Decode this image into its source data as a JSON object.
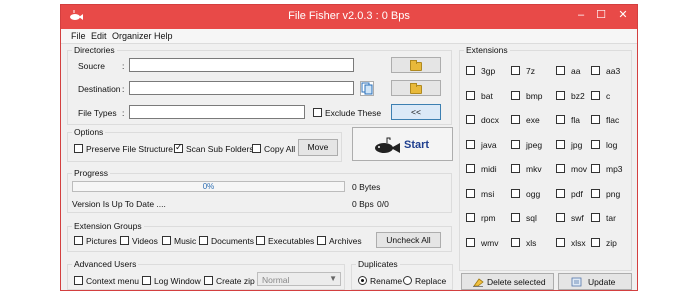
{
  "window": {
    "title": "File Fisher v2.0.3 : 0 Bps",
    "minimize": "–",
    "maximize": "☐",
    "close": "✕"
  },
  "menu": [
    "File",
    "Edit",
    "Organizer",
    "Help"
  ],
  "directories": {
    "legend": "Directories",
    "source_label": "Soucre",
    "destination_label": "Destination",
    "filetypes_label": "File Types",
    "colon": ":",
    "source_value": "",
    "destination_value": "",
    "filetypes_value": "",
    "exclude_label": "Exclude These",
    "toggle_button": "<<"
  },
  "options": {
    "legend": "Options",
    "preserve_label": "Preserve File Structure",
    "scan_sub_label": "Scan Sub Folders",
    "copy_all_label": "Copy All",
    "move_button": "Move"
  },
  "start_button": "Start",
  "progress": {
    "legend": "Progress",
    "percent_text": "0%",
    "percent": 0,
    "bytes_text": "0 Bytes",
    "version_status": "Version Is Up To Date ....",
    "speed": "0 Bps",
    "count": "0/0"
  },
  "extension_groups": {
    "legend": "Extension Groups",
    "items": [
      "Pictures",
      "Videos",
      "Music",
      "Documents",
      "Executables",
      "Archives"
    ],
    "uncheck_button": "Uncheck All"
  },
  "advanced": {
    "legend": "Advanced Users",
    "context_label": "Context menu",
    "log_label": "Log Window",
    "zip_label": "Create zip",
    "zip_mode": "Normal"
  },
  "duplicates": {
    "legend": "Duplicates",
    "rename": "Rename",
    "replace": "Replace"
  },
  "extensions": {
    "legend": "Extensions",
    "items": [
      "3gp",
      "7z",
      "aa",
      "aa3",
      "bat",
      "bmp",
      "bz2",
      "c",
      "docx",
      "exe",
      "fla",
      "flac",
      "java",
      "jpeg",
      "jpg",
      "log",
      "midi",
      "mkv",
      "mov",
      "mp3",
      "msi",
      "ogg",
      "pdf",
      "png",
      "rpm",
      "sql",
      "swf",
      "tar",
      "wmv",
      "xls",
      "xlsx",
      "zip"
    ],
    "delete_button": "Delete selected",
    "update_button": "Update"
  },
  "colors": {
    "titlebar": "#e84a48",
    "window_bg": "#f0f0f0",
    "progress_fill": "#1e8bd6"
  }
}
